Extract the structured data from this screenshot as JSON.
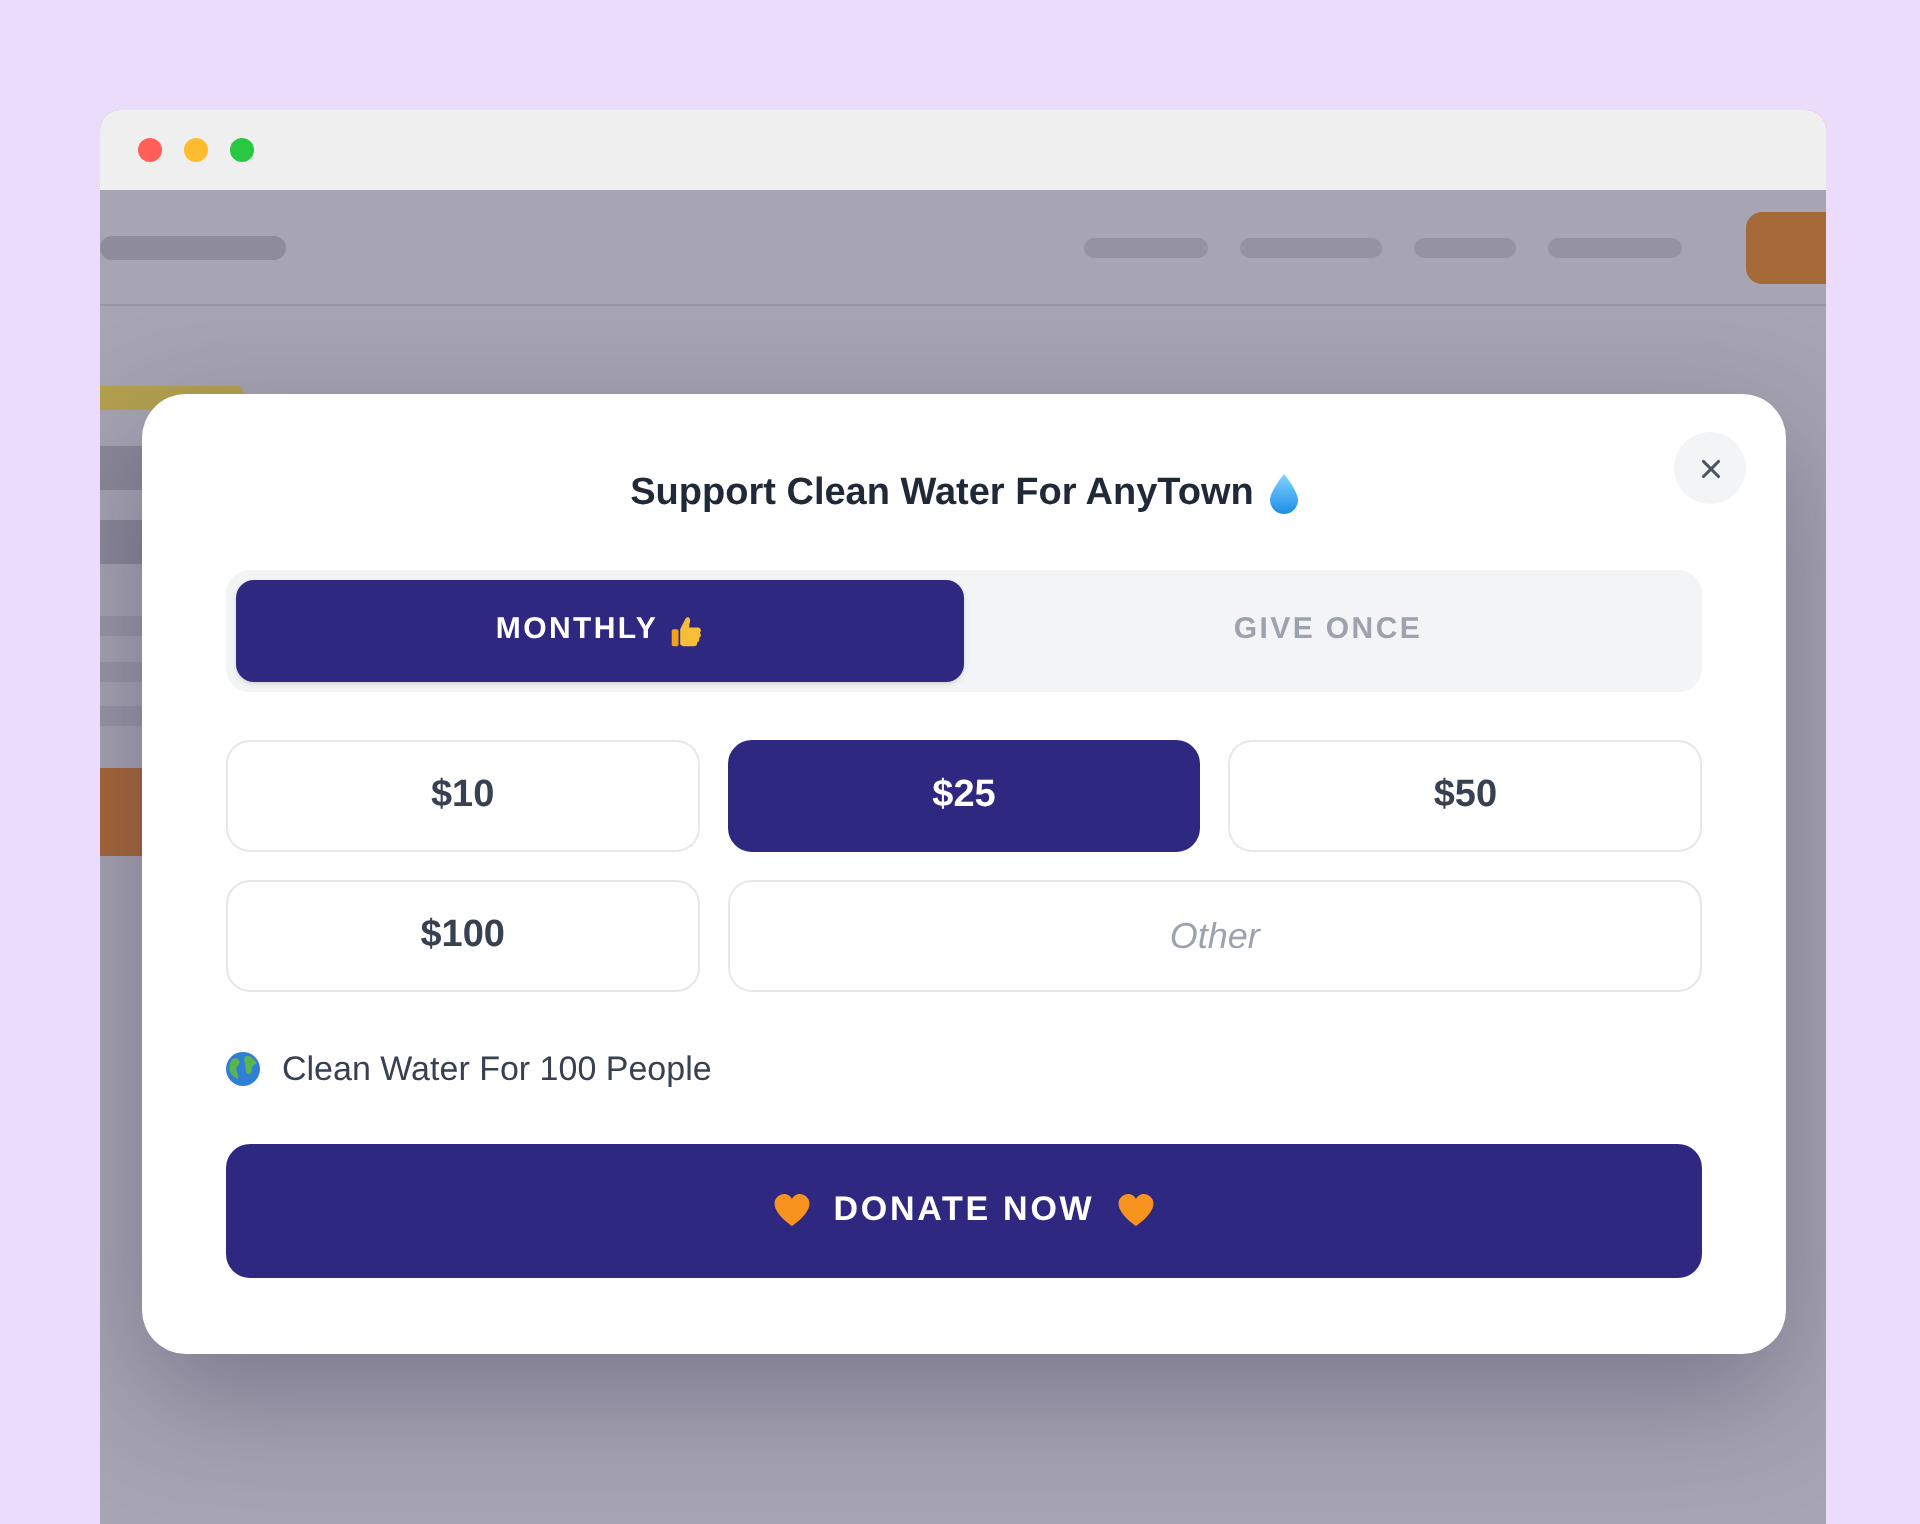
{
  "dialog": {
    "title": "Support Clean Water For AnyTown"
  },
  "frequency_tabs": [
    {
      "label": "MONTHLY",
      "selected": true
    },
    {
      "label": "GIVE ONCE",
      "selected": false
    }
  ],
  "amounts": [
    {
      "label": "$10",
      "selected": false
    },
    {
      "label": "$25",
      "selected": true
    },
    {
      "label": "$50",
      "selected": false
    },
    {
      "label": "$100",
      "selected": false
    }
  ],
  "other_amount": {
    "placeholder": "Other"
  },
  "impact": {
    "text": "Clean Water For 100 People"
  },
  "donate_button": {
    "label": "DONATE NOW"
  }
}
